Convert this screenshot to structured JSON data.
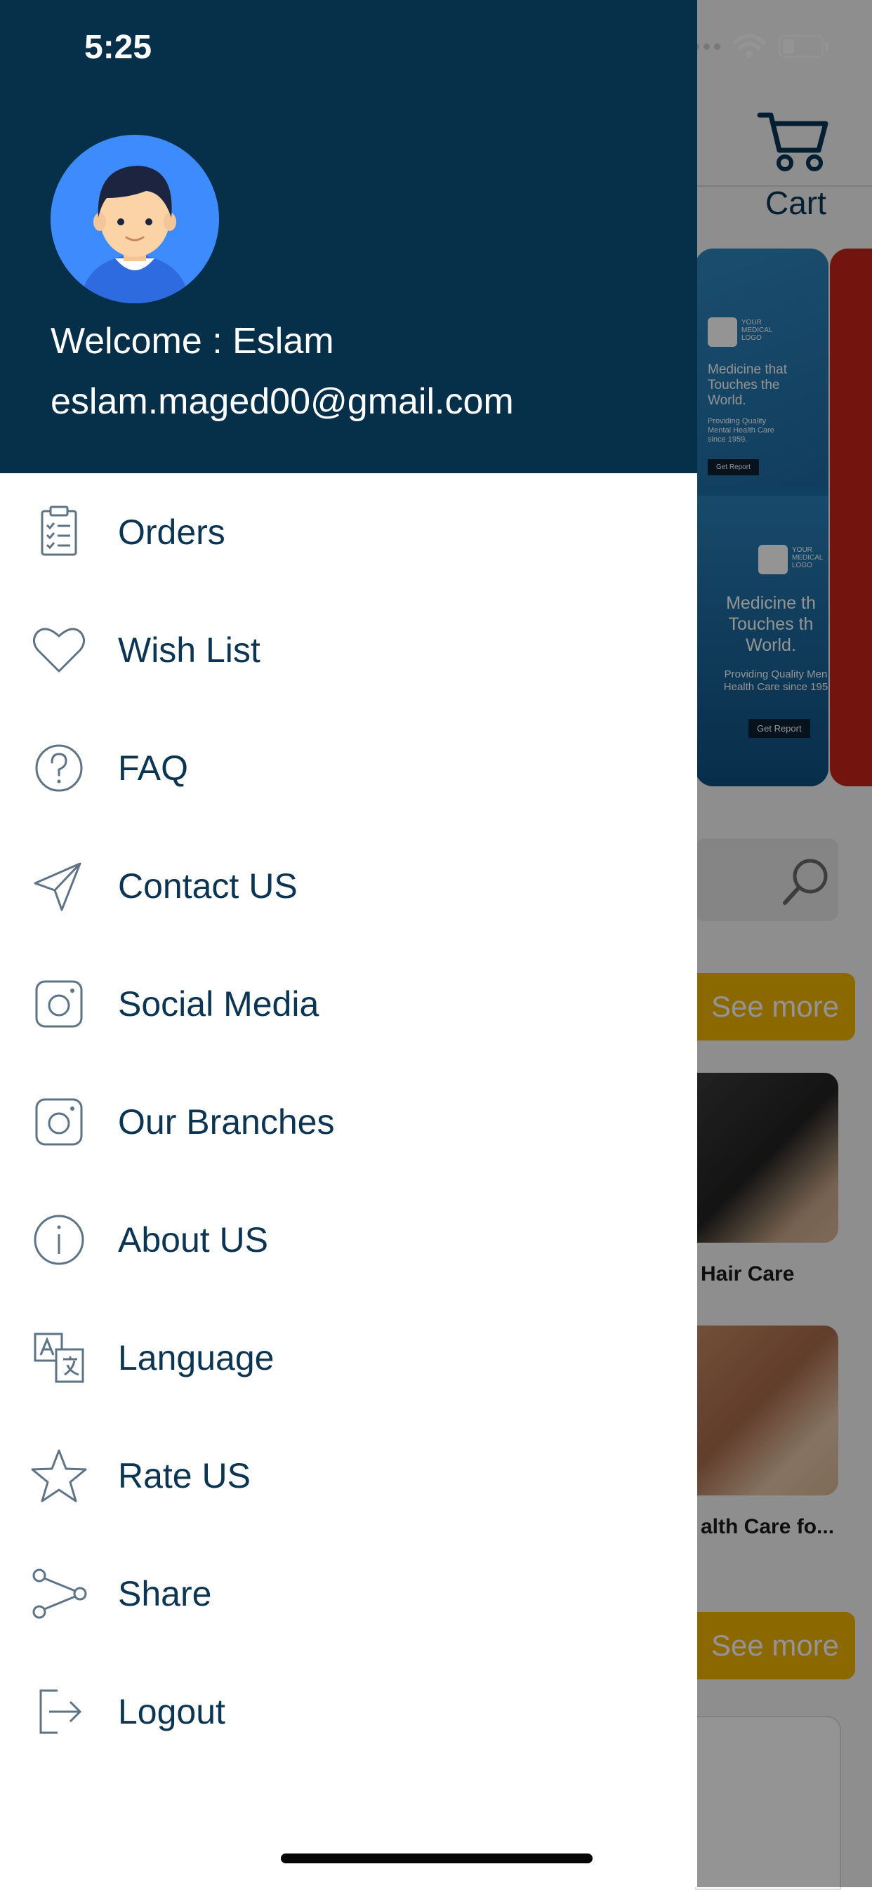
{
  "status_bar": {
    "time": "5:25"
  },
  "user": {
    "welcome": "Welcome : Eslam",
    "email": "eslam.maged00@gmail.com"
  },
  "menu": {
    "items": [
      {
        "label": "Orders",
        "icon": "clipboard-icon"
      },
      {
        "label": "Wish List",
        "icon": "heart-icon"
      },
      {
        "label": "FAQ",
        "icon": "question-circle-icon"
      },
      {
        "label": "Contact US",
        "icon": "paper-plane-icon"
      },
      {
        "label": "Social Media",
        "icon": "instagram-icon"
      },
      {
        "label": "Our Branches",
        "icon": "instagram-icon"
      },
      {
        "label": "About US",
        "icon": "info-circle-icon"
      },
      {
        "label": "Language",
        "icon": "translate-icon"
      },
      {
        "label": "Rate US",
        "icon": "star-icon"
      },
      {
        "label": "Share",
        "icon": "share-icon"
      },
      {
        "label": "Logout",
        "icon": "logout-icon"
      }
    ]
  },
  "background": {
    "cart_label": "Cart",
    "banner_1": {
      "logo_text": "YOUR MEDICAL LOGO",
      "headline_top": "Medicine that Touches the World.",
      "sub_top": "Providing Quality Mental Health Care since 1959.",
      "button_top": "Get Report",
      "headline_bottom": "Medicine th Touches th World.",
      "sub_bottom": "Providing Quality Men Health Care since 195",
      "button_bottom": "Get Report"
    },
    "see_more_1": "See more",
    "see_more_2": "See more",
    "product_1_label": "Hair Care",
    "product_2_label": "alth Care fo..."
  },
  "colors": {
    "header_bg": "#062f4a",
    "menu_text": "#0b3553",
    "icon_stroke": "#5e7486",
    "accent": "#f0b400"
  }
}
